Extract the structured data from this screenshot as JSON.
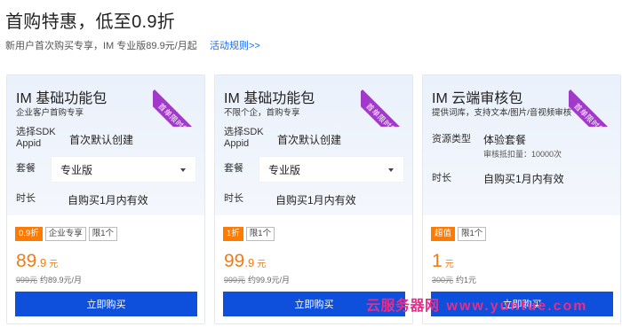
{
  "header": {
    "title": "首购特惠，低至0.9折",
    "subtitle": "新用户首次购买专享，IM 专业版89.9元/月起",
    "rules_link": "活动规则>>"
  },
  "cards": [
    {
      "name": "IM 基础功能包",
      "desc": "企业客户首购专享",
      "ribbon": "首单限时特惠",
      "rows": [
        {
          "label": "选择SDK\nAppid",
          "value": "首次默认创建"
        },
        {
          "label": "套餐",
          "select": "专业版"
        },
        {
          "label": "时长",
          "value": "自购买1月内有效"
        }
      ],
      "tags": [
        "0.9折",
        "企业专享",
        "限1个"
      ],
      "price_int": "89",
      "price_dec": ".9",
      "price_unit": "元",
      "orig_price": "999元",
      "orig_note": "约89.9元/月",
      "buy": "立即购买"
    },
    {
      "name": "IM 基础功能包",
      "desc": "不限个企，首购专享",
      "ribbon": "首单限时特惠",
      "rows": [
        {
          "label": "选择SDK\nAppid",
          "value": "首次默认创建"
        },
        {
          "label": "套餐",
          "select": "专业版"
        },
        {
          "label": "时长",
          "value": "自购买1月内有效"
        }
      ],
      "tags": [
        "1折",
        "限1个"
      ],
      "price_int": "99",
      "price_dec": ".9",
      "price_unit": "元",
      "orig_price": "999元",
      "orig_note": "约99.9元/月",
      "buy": "立即购买"
    },
    {
      "name": "IM 云端审核包",
      "desc": "提供词库，支持文本/图片/音视频审核",
      "ribbon": "首单限时特惠",
      "rows": [
        {
          "label": "资源类型",
          "value": "体验套餐",
          "sub": "审核抵扣量：10000次"
        },
        {
          "label": "时长",
          "value": "自购买1月内有效"
        }
      ],
      "tags": [
        "超值",
        "限1个"
      ],
      "price_int": "1",
      "price_dec": "",
      "price_unit": "元",
      "orig_price": "300元",
      "orig_note": "约1元",
      "buy": "立即购买"
    }
  ],
  "watermark": {
    "text_a": "云服务器网",
    "text_b": "www.yuntue.com"
  },
  "colors": {
    "accent": "#0e4fdb",
    "price": "#f07c16",
    "ribbon": "#a23ac9",
    "hot_tag": "#ff7a00"
  }
}
